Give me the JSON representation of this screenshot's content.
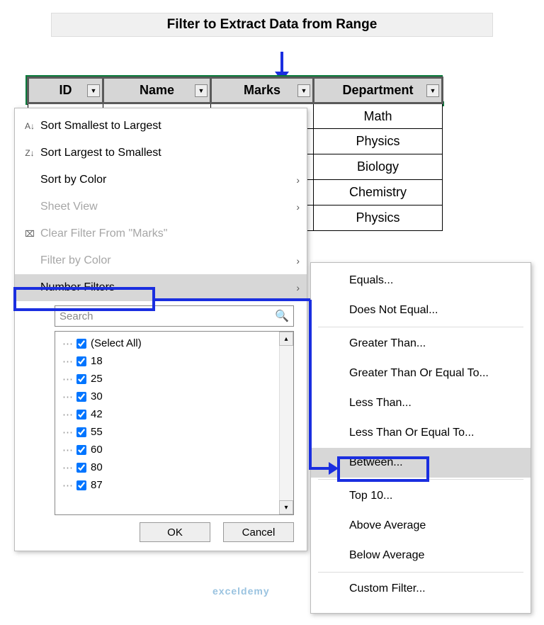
{
  "title": "Filter to Extract Data from Range",
  "columns": {
    "id": "ID",
    "name": "Name",
    "marks": "Marks",
    "dept": "Department"
  },
  "dept_values": [
    "Math",
    "Physics",
    "Biology",
    "Chemistry",
    "Physics"
  ],
  "menu": {
    "sort_asc": "Sort Smallest to Largest",
    "sort_desc": "Sort Largest to Smallest",
    "sort_color": "Sort by Color",
    "sheet_view": "Sheet View",
    "clear_filter": "Clear Filter From \"Marks\"",
    "filter_color": "Filter by Color",
    "number_filters": "Number Filters",
    "search_placeholder": "Search",
    "ok": "OK",
    "cancel": "Cancel"
  },
  "tree": [
    "(Select All)",
    "18",
    "25",
    "30",
    "42",
    "55",
    "60",
    "80",
    "87"
  ],
  "submenu": {
    "equals": "Equals...",
    "not_equal": "Does Not Equal...",
    "gt": "Greater Than...",
    "gte": "Greater Than Or Equal To...",
    "lt": "Less Than...",
    "lte": "Less Than Or Equal To...",
    "between": "Between...",
    "top10": "Top 10...",
    "above_avg": "Above Average",
    "below_avg": "Below Average",
    "custom": "Custom Filter..."
  },
  "watermark": "exceldemy"
}
